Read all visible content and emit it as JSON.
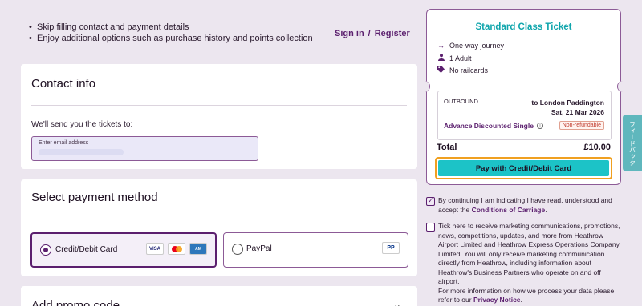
{
  "benefits": [
    "Skip filling contact and payment details",
    "Enjoy additional options such as purchase history and points collection"
  ],
  "auth": {
    "signin": "Sign in",
    "separator": "/",
    "register": "Register"
  },
  "contact": {
    "title": "Contact info",
    "send_text": "We'll send you the tickets to:",
    "email_placeholder": "Enter email address"
  },
  "payment": {
    "title": "Select payment method",
    "options": [
      {
        "label": "Credit/Debit Card",
        "selected": true
      },
      {
        "label": "PayPal",
        "selected": false
      }
    ],
    "logos": [
      "VISA",
      "MC",
      "AMEX",
      "PP"
    ]
  },
  "promo": {
    "title": "Add promo code"
  },
  "summary": {
    "title": "Standard Class Ticket",
    "rows": [
      {
        "icon": "arrow-right-icon",
        "text": "One-way journey"
      },
      {
        "icon": "person-icon",
        "text": "1 Adult"
      },
      {
        "icon": "tag-icon",
        "text": "No railcards"
      }
    ],
    "journey": {
      "direction": "OUTBOUND",
      "destination": "to London Paddington",
      "date": "Sat, 21 Mar 2026",
      "fare": "Advance Discounted Single",
      "refund": "Non-refundable"
    },
    "total_label": "Total",
    "total_value": "£10.00",
    "pay_button": "Pay with Credit/Debit Card"
  },
  "conditions": {
    "text": "By continuing I am indicating I have read, understood and accept the ",
    "link": "Conditions of Carriage",
    "suffix": ".",
    "checked": true
  },
  "marketing": {
    "text": "Tick here to receive marketing communications, promotions, news, competitions, updates, and more from Heathrow Airport Limited and Heathrow Express Operations Company Limited. You will only receive marketing communication directly from Heathrow, including information about Heathrow's Business Partners who operate on and off airport.",
    "more": "For more information on how we process your data please refer to our ",
    "link": "Privacy Notice",
    "suffix": ".",
    "checked": false
  },
  "feedback_tab": "フィードバック",
  "colors": {
    "brand": "#5b1f6e",
    "accent": "#1cc3c7",
    "title_teal": "#0fa5ac",
    "focus": "#f0a020"
  }
}
